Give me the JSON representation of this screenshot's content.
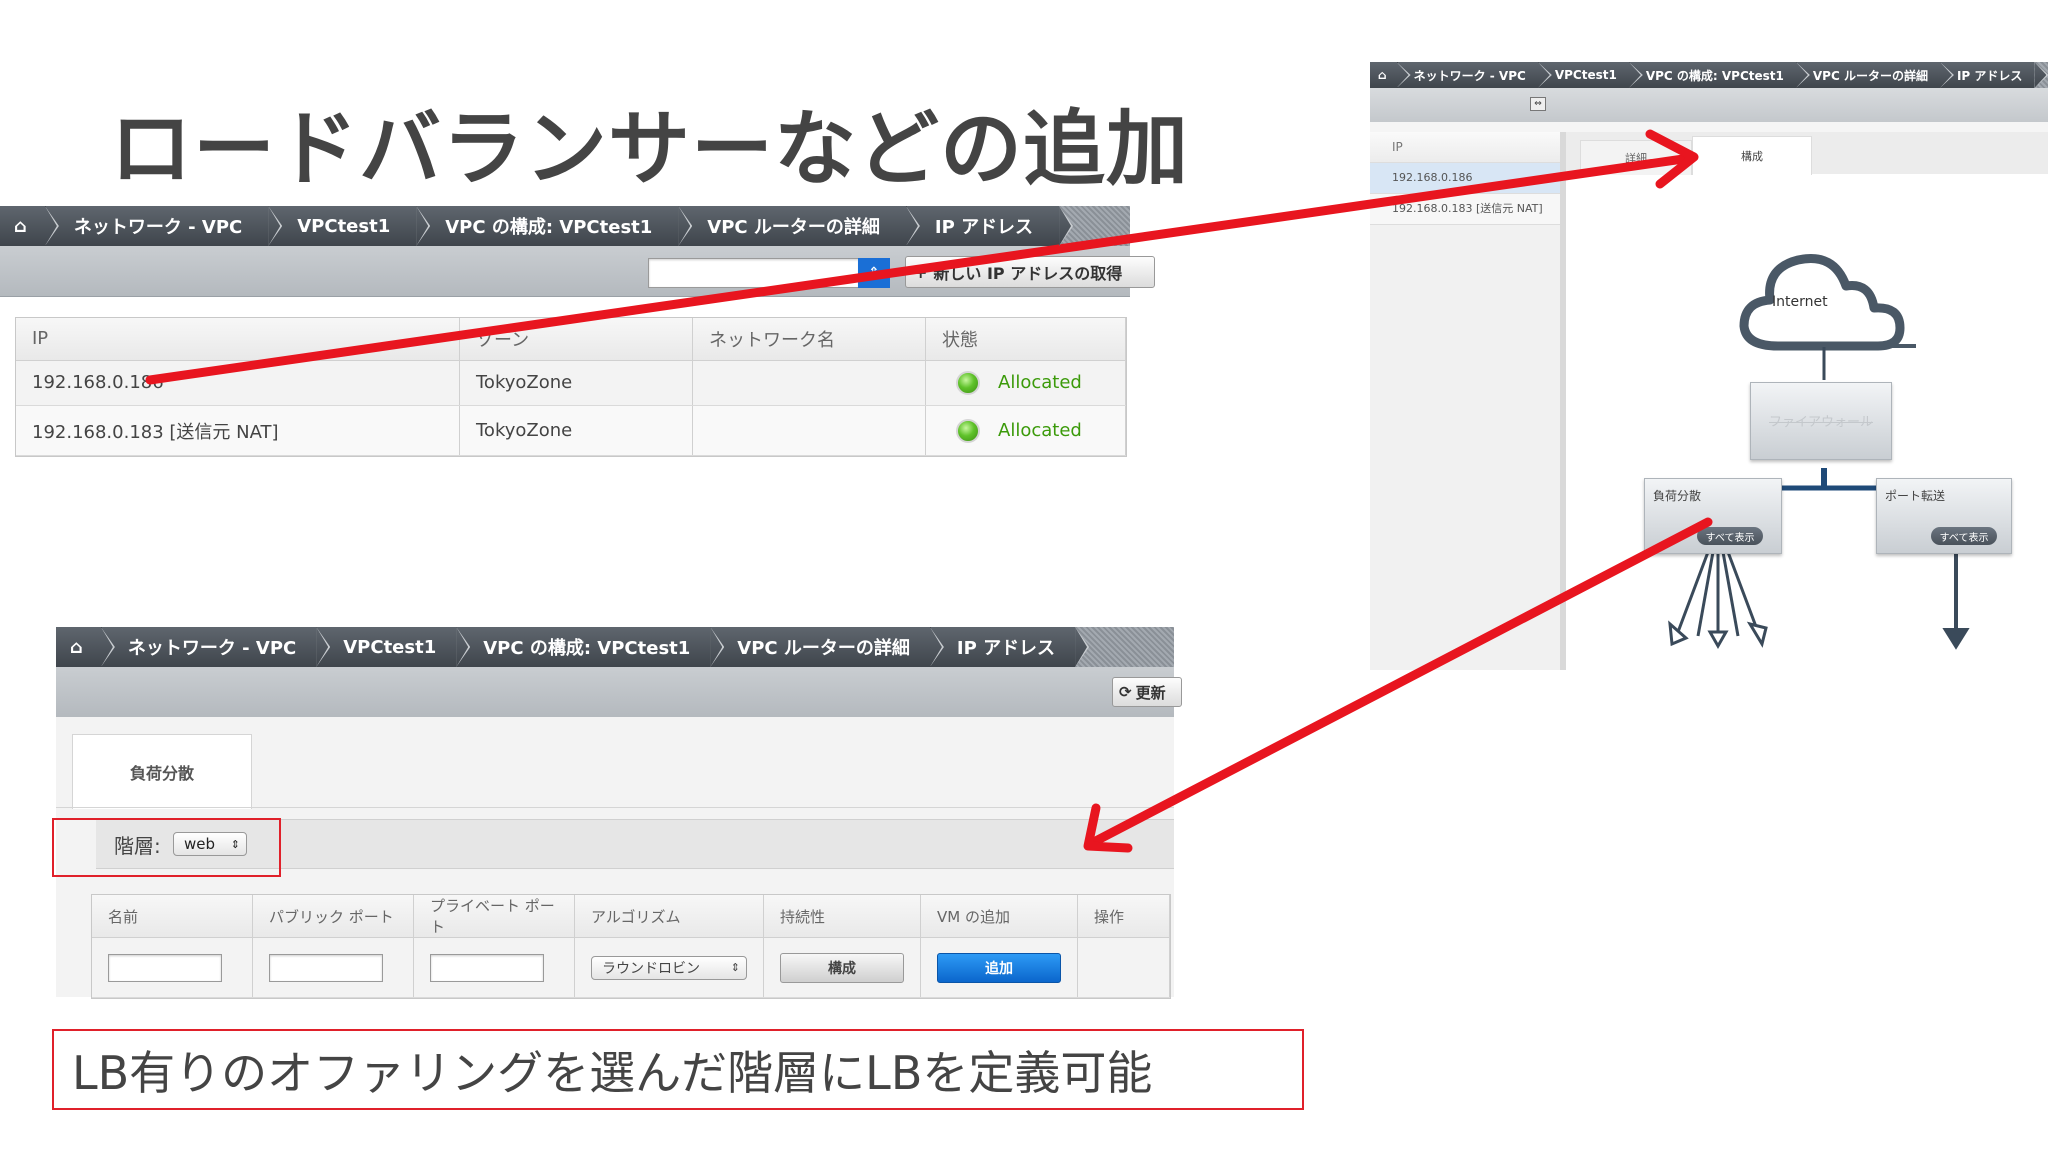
{
  "slide": {
    "title": "ロードバランサーなどの追加",
    "note": "LB有りのオファリングを選んだ階層にLBを定義可能"
  },
  "breadcrumb": {
    "home_icon": "home-icon",
    "items": [
      "ネットワーク - VPC",
      "VPCtest1",
      "VPC の構成: VPCtest1",
      "VPC ルーターの詳細",
      "IP アドレス"
    ]
  },
  "ip_screen": {
    "toolbar": {
      "acquire_label": "新しい IP アドレスの取得",
      "select_value": ""
    },
    "columns": [
      "IP",
      "ゾーン",
      "ネットワーク名",
      "状態"
    ],
    "rows": [
      {
        "ip": "192.168.0.186",
        "zone": "TokyoZone",
        "network": "",
        "status": "Allocated"
      },
      {
        "ip": "192.168.0.183 [送信元 NAT]",
        "zone": "TokyoZone",
        "network": "",
        "status": "Allocated"
      }
    ],
    "status_color": "#3b9a0a"
  },
  "lb_screen": {
    "refresh_label": "更新",
    "tab": "負荷分散",
    "tier_label": "階層:",
    "tier_value": "web",
    "columns": [
      "名前",
      "パブリック ポート",
      "プライベート ポート",
      "アルゴリズム",
      "持続性",
      "VM の追加",
      "操作"
    ],
    "algorithm_value": "ラウンドロビン",
    "persistence_button": "構成",
    "add_vm_button": "追加",
    "add_button_color": "#1a7ee0"
  },
  "detail_screen": {
    "breadcrumb": [
      "ネットワーク - VPC",
      "VPCtest1",
      "VPC の構成: VPCtest1",
      "VPC ルーターの詳細",
      "IP アドレス"
    ],
    "list_header": "IP",
    "list_items": [
      "192.168.0.186",
      "192.168.0.183 [送信元 NAT]"
    ],
    "tabs": [
      "詳細",
      "構成"
    ],
    "internet_label": "Internet",
    "firewall_label": "ファイアウォール",
    "lb_label": "負荷分散",
    "pf_label": "ポート転送",
    "show_all_label": "すべて表示"
  },
  "colors": {
    "annotation_red": "#e8151f",
    "header_dark": "#4a5158"
  }
}
